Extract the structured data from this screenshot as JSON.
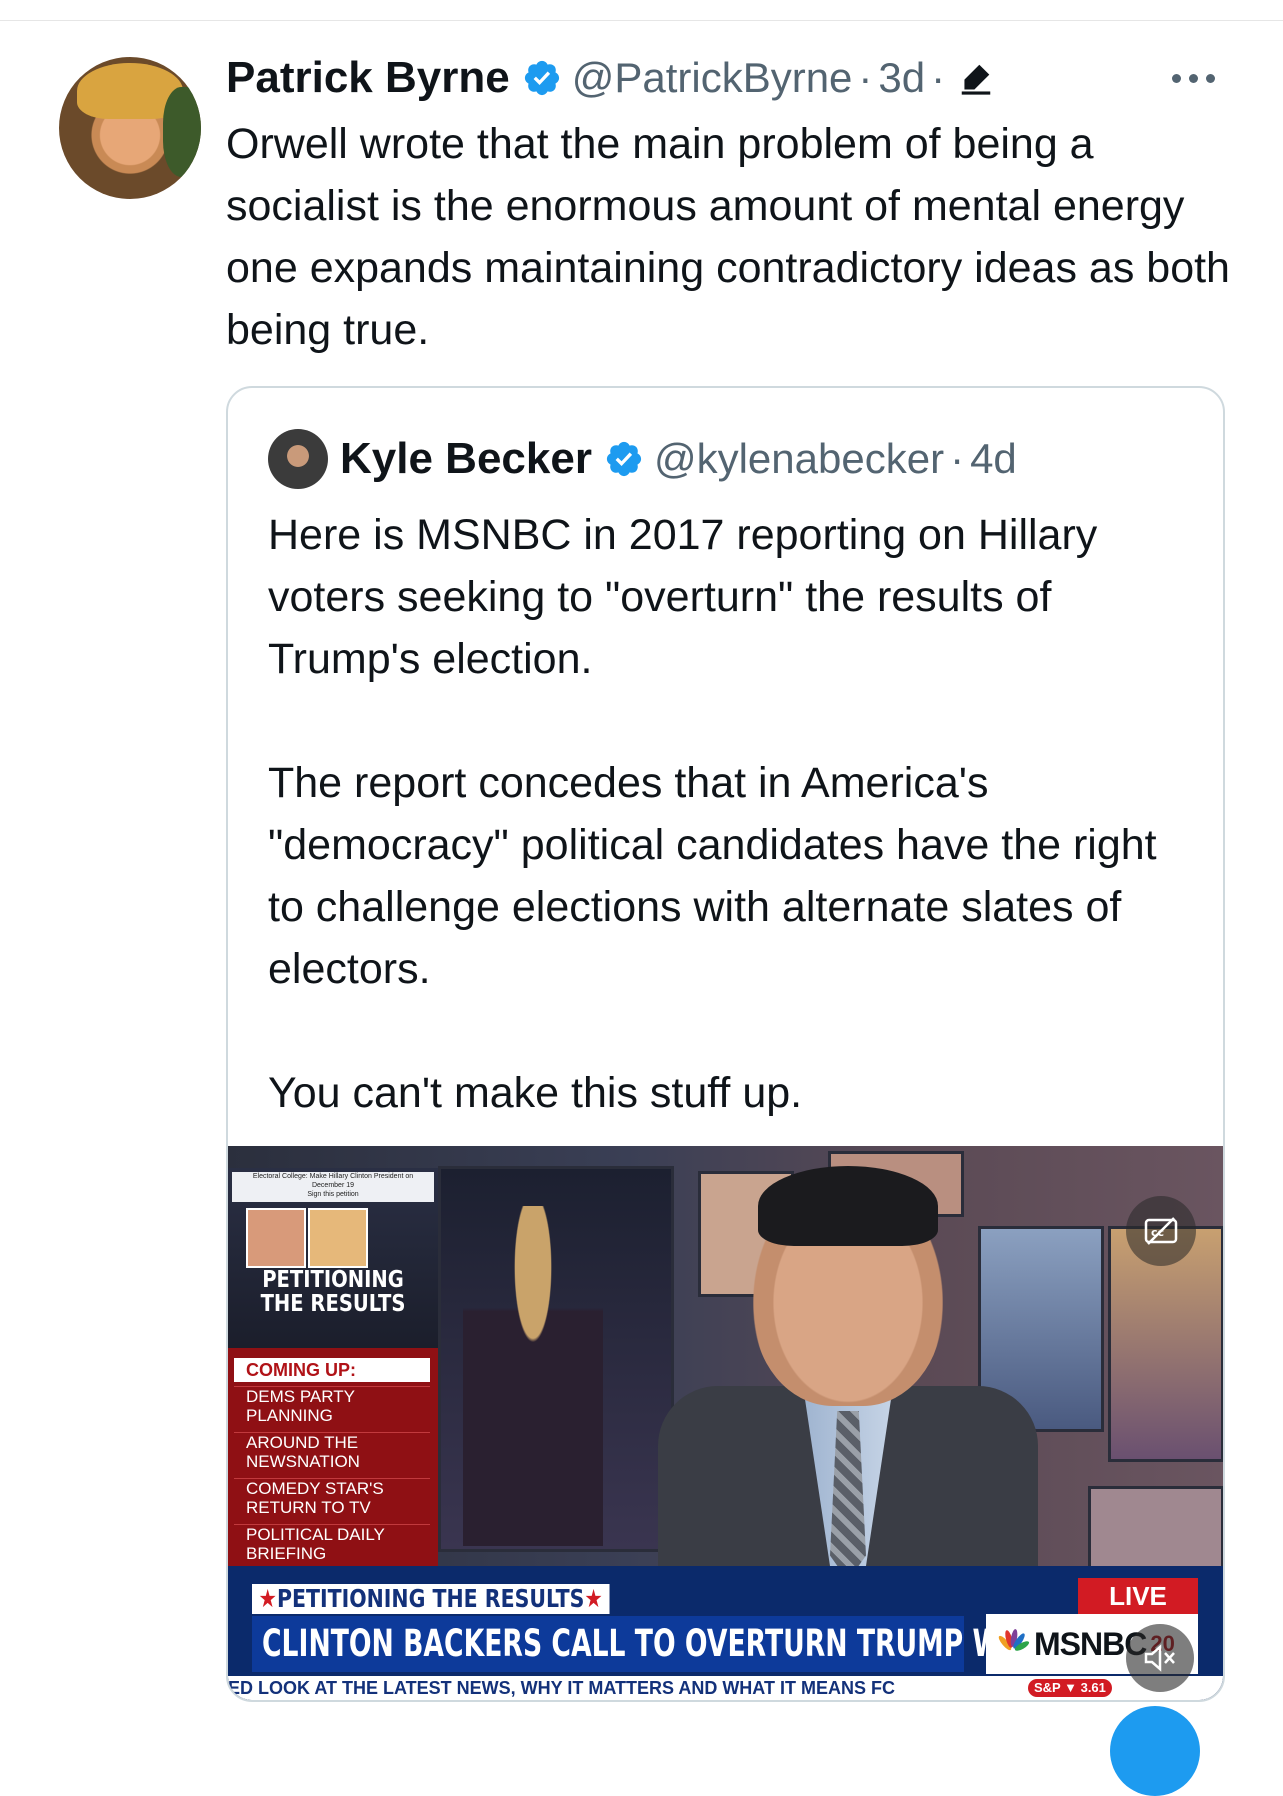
{
  "tweet": {
    "author_name": "Patrick Byrne",
    "handle": "@PatrickByrne",
    "separator": "·",
    "age": "3d",
    "age_suffix": "·",
    "text": "Orwell wrote that the main problem of being a socialist is the enormous amount of mental energy one expands maintaining contradictory ideas as both being true."
  },
  "quoted": {
    "author_name": "Kyle Becker",
    "handle": "@kylenabecker",
    "separator": "·",
    "age": "4d",
    "paragraphs": [
      "Here is MSNBC in 2017 reporting on Hillary voters seeking to \"overturn\" the results of Trump's election.",
      "The report concedes that in America's \"democracy\" political candidates have the right to challenge elections with alternate slates of electors.",
      "You can't make this stuff up."
    ]
  },
  "video": {
    "thumb_header_line1": "Electoral College: Make Hillary Clinton President on",
    "thumb_header_line2": "December 19",
    "thumb_header_line3": "Sign this petition",
    "thumb_title_line1": "PETITIONING",
    "thumb_title_line2": "THE RESULTS",
    "coming_up": "COMING UP:",
    "sidebar_items": [
      {
        "line1": "DEMS PARTY",
        "line2": "PLANNING"
      },
      {
        "line1": "AROUND THE",
        "line2": "NEWSNATION"
      },
      {
        "line1": "COMEDY STAR'S",
        "line2": "RETURN TO TV"
      },
      {
        "line1": "POLITICAL DAILY",
        "line2": "BRIEFING"
      }
    ],
    "kicker": "PETITIONING THE RESULTS",
    "kicker_star": "★",
    "headline": "CLINTON BACKERS CALL TO OVERTURN TRUMP WIN",
    "live": "LIVE",
    "network": "MSNBC",
    "network_badge": "20",
    "ticker": "ED LOOK AT THE LATEST NEWS, WHY IT MATTERS AND WHAT IT MEANS FC",
    "market_label": "S&P",
    "market_value": "3.61"
  },
  "icons": {
    "verified": "verified-badge-icon",
    "edit": "edit-pencil-icon",
    "more": "more-options-icon",
    "captions": "closed-captions-icon",
    "mute": "volume-muted-icon"
  },
  "colors": {
    "accent": "#1d9bf0",
    "secondary_text": "#536471",
    "msnbc_red": "#d21b23",
    "msnbc_blue": "#0d3a9a"
  }
}
